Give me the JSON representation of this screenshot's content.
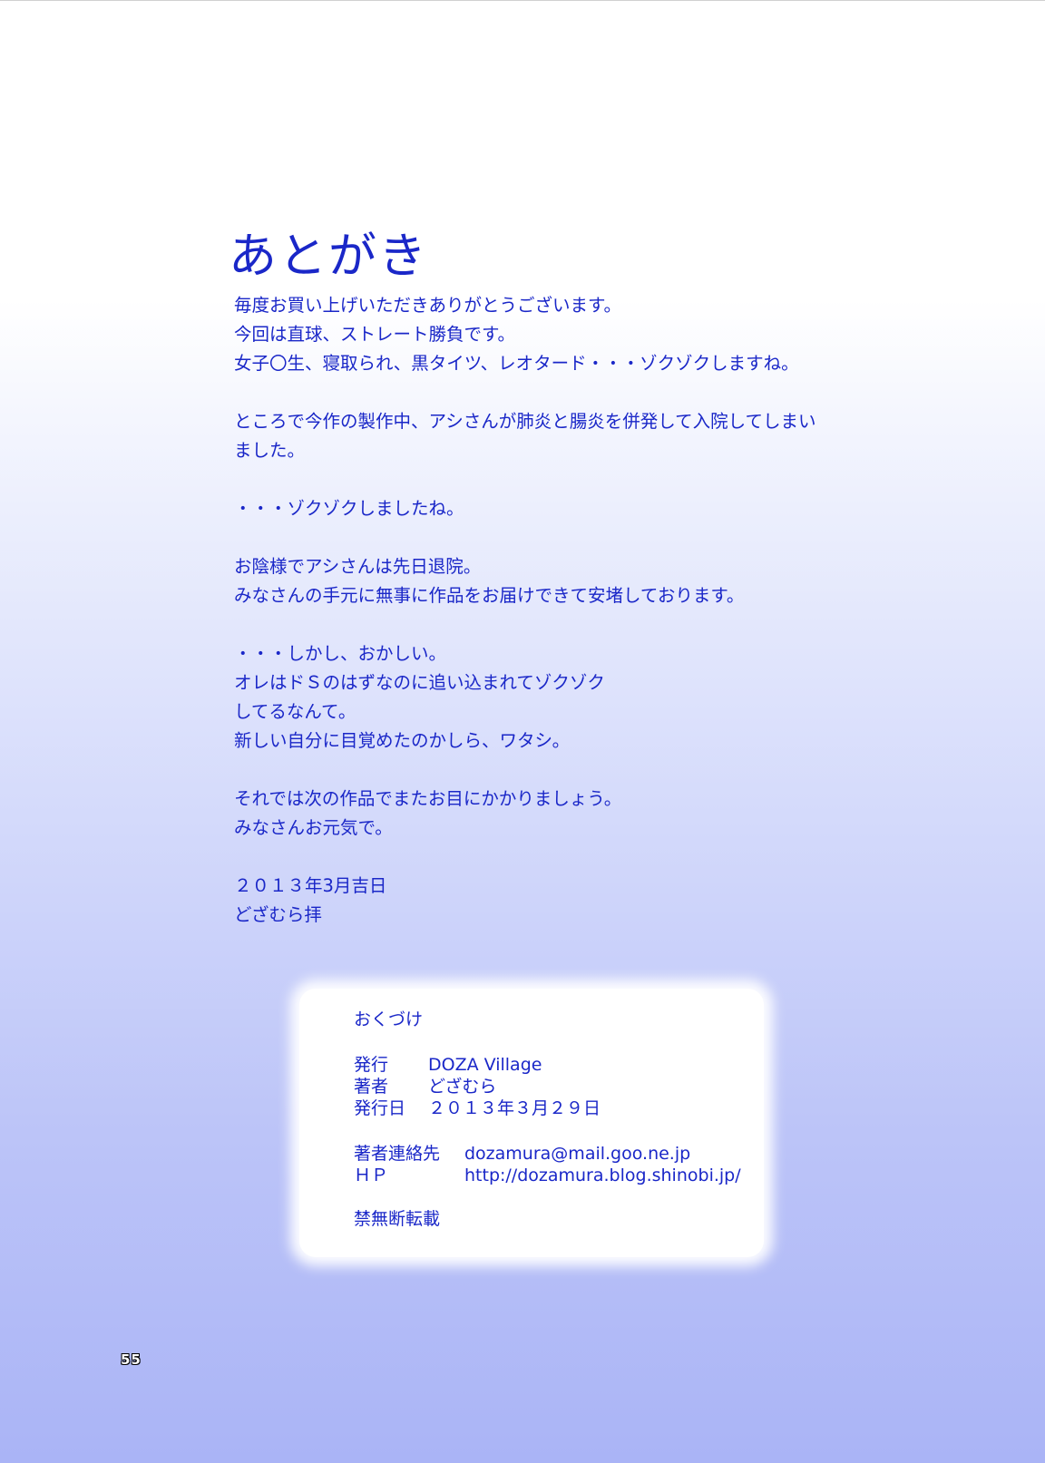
{
  "title": "あとがき",
  "paragraphs": [
    [
      "毎度お買い上げいただきありがとうございます。",
      "今回は直球、ストレート勝負です。",
      "女子〇生、寝取られ、黒タイツ、レオタード・・・ゾクゾクしますね。"
    ],
    [
      "ところで今作の製作中、アシさんが肺炎と腸炎を併発して入院してしまい",
      "ました。"
    ],
    [
      "・・・ゾクゾクしましたね。"
    ],
    [
      "お陰様でアシさんは先日退院。",
      "みなさんの手元に無事に作品をお届けできて安堵しております。"
    ],
    [
      "・・・しかし、おかしい。",
      "オレはドＳのはずなのに追い込まれてゾクゾク",
      "してるなんて。",
      "新しい自分に目覚めたのかしら、ワタシ。"
    ],
    [
      "それでは次の作品でまたお目にかかりましょう。",
      "みなさんお元気で。"
    ],
    [
      "２０１３年3月吉日",
      "どざむら拝"
    ]
  ],
  "colophon": {
    "title": "おくづけ",
    "publisher_label": "発行",
    "publisher": "DOZA Village",
    "author_label": "著者",
    "author": "どざむら",
    "date_label": "発行日",
    "date": "２０１３年３月２９日",
    "contact_label": "著者連絡先",
    "contact": "dozamura@mail.goo.ne.jp",
    "hp_label": "ＨＰ",
    "hp": "http://dozamura.blog.shinobi.jp/",
    "notice": "禁無断転載"
  },
  "page_number": "55",
  "colors": {
    "text": "#1a27c8",
    "background_top": "#ffffff",
    "background_bottom": "#aab4f6"
  }
}
